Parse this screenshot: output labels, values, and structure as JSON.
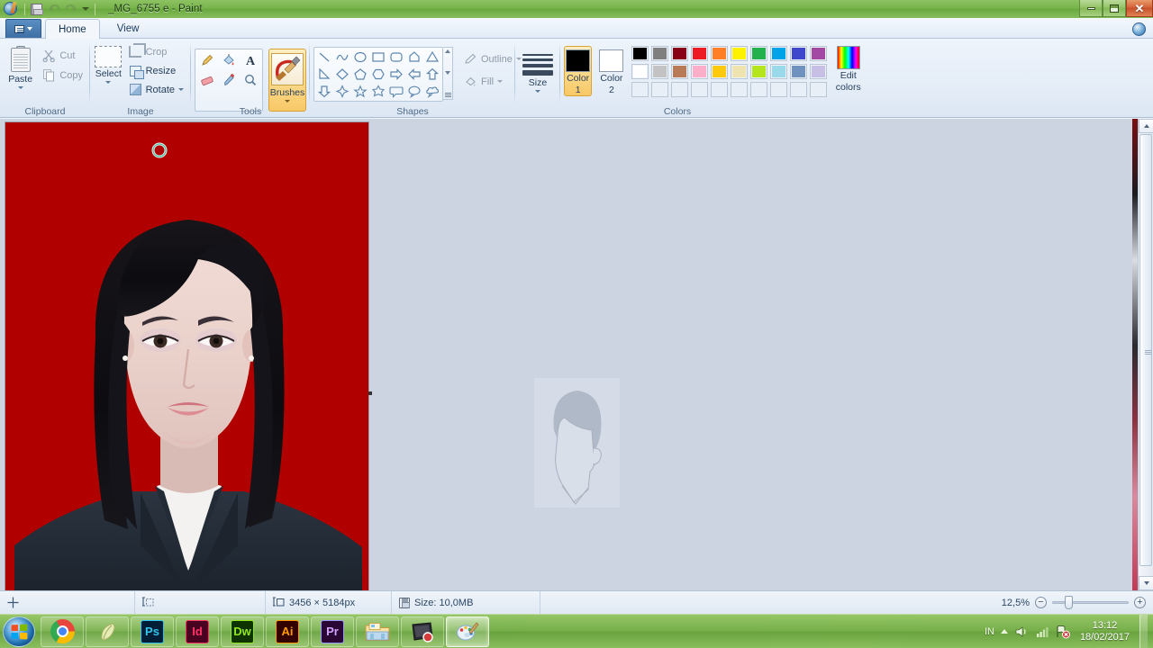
{
  "window": {
    "title": "_MG_6755 e - Paint",
    "quick_access": [
      "save-icon",
      "undo-icon",
      "redo-icon",
      "customize-qat-icon"
    ],
    "controls": {
      "minimize": "minimize-icon",
      "restore": "restore-icon",
      "close": "✕"
    },
    "help_icon": "help-icon"
  },
  "tabs": {
    "app_menu_label": "menu-icon",
    "items": [
      {
        "label": "Home",
        "active": true
      },
      {
        "label": "View",
        "active": false
      }
    ]
  },
  "ribbon": {
    "groups": [
      {
        "name": "Clipboard",
        "label": "Clipboard",
        "big_button": {
          "label": "Paste",
          "icon": "paste-icon",
          "has_caret": true
        },
        "small_buttons": [
          {
            "label": "Cut",
            "icon": "scissors-icon",
            "enabled": false
          },
          {
            "label": "Copy",
            "icon": "copy-icon",
            "enabled": false
          }
        ]
      },
      {
        "name": "Image",
        "label": "Image",
        "big_button": {
          "label": "Select",
          "icon": "select-rectangle-icon",
          "has_caret": true
        },
        "small_buttons": [
          {
            "label": "Crop",
            "icon": "crop-icon",
            "enabled": false
          },
          {
            "label": "Resize",
            "icon": "resize-icon",
            "enabled": true
          },
          {
            "label": "Rotate",
            "icon": "rotate-icon",
            "enabled": true,
            "has_caret": true
          }
        ]
      },
      {
        "name": "Tools",
        "label": "Tools",
        "tools": [
          "pencil-icon",
          "fill-with-color-icon",
          "text-icon",
          "eraser-icon",
          "color-picker-icon",
          "magnifier-icon"
        ],
        "brushes": {
          "label": "Brushes",
          "icon": "brush-icon",
          "selected": true,
          "has_caret": true
        }
      },
      {
        "name": "Shapes",
        "label": "Shapes",
        "shapes": [
          "line",
          "curve",
          "oval",
          "rectangle",
          "rounded-rectangle",
          "polygon",
          "triangle",
          "right-triangle",
          "diamond",
          "pentagon",
          "hexagon",
          "right-arrow",
          "left-arrow",
          "up-arrow",
          "down-arrow",
          "four-point-star",
          "five-point-star",
          "six-point-star",
          "rounded-callout",
          "oval-callout",
          "cloud-callout"
        ],
        "outline": {
          "label": "Outline",
          "enabled": false,
          "has_caret": true,
          "icon": "outline-icon"
        },
        "fill": {
          "label": "Fill",
          "enabled": false,
          "has_caret": true,
          "icon": "fill-icon"
        }
      },
      {
        "name": "Size",
        "label": "",
        "size_button": {
          "label": "Size",
          "icon": "size-lines-icon",
          "has_caret": true
        }
      },
      {
        "name": "Colors",
        "label": "Colors",
        "color1": {
          "label_top": "Color",
          "label_bottom": "1",
          "value": "#000000",
          "selected": true
        },
        "color2": {
          "label_top": "Color",
          "label_bottom": "2",
          "value": "#ffffff",
          "selected": false
        },
        "palette_row1": [
          "#000000",
          "#7f7f7f",
          "#880015",
          "#ed1c24",
          "#ff7f27",
          "#fff200",
          "#22b14c",
          "#00a2e8",
          "#3f48cc",
          "#a349a4"
        ],
        "palette_row2": [
          "#ffffff",
          "#c3c3c3",
          "#b97a57",
          "#ffaec9",
          "#ffc90e",
          "#efe4b0",
          "#b5e61d",
          "#99d9ea",
          "#7092be",
          "#c8bfe7"
        ],
        "palette_row3": [
          "",
          "",
          "",
          "",
          "",
          "",
          "",
          "",
          "",
          ""
        ],
        "edit_colors": {
          "label_top": "Edit",
          "label_bottom": "colors",
          "icon": "edit-colors-icon"
        }
      }
    ]
  },
  "canvas": {
    "background_color": "#ccd4e1",
    "image_background": "#b00000",
    "ghost_overlay": "id-photo-silhouette",
    "cursor": "brush-ring-cursor"
  },
  "statusbar": {
    "cursor_position": "",
    "selection_size": "",
    "image_dimensions": "3456 × 5184px",
    "file_size": "Size: 10,0MB",
    "zoom_level": "12,5%",
    "zoom_out": "−",
    "zoom_in": "+"
  },
  "taskbar": {
    "start": "windows-start-orb",
    "items": [
      {
        "name": "chrome",
        "label": "",
        "active": false
      },
      {
        "name": "app-feather",
        "label": "",
        "active": false
      },
      {
        "name": "photoshop",
        "label": "Ps",
        "active": false,
        "fg": "#31c5f0",
        "bg": "#001e36",
        "border": "#31c5f0"
      },
      {
        "name": "indesign",
        "label": "Id",
        "active": false,
        "fg": "#ff3366",
        "bg": "#49021f",
        "border": "#ff3366"
      },
      {
        "name": "dreamweaver",
        "label": "Dw",
        "active": false,
        "fg": "#8fe71f",
        "bg": "#0e3300",
        "border": "#8fe71f"
      },
      {
        "name": "illustrator",
        "label": "Ai",
        "active": false,
        "fg": "#ff9a00",
        "bg": "#330000",
        "border": "#ff9a00"
      },
      {
        "name": "premiere",
        "label": "Pr",
        "active": false,
        "fg": "#d5a3ff",
        "bg": "#2a0634",
        "border": "#9999ff"
      },
      {
        "name": "file-explorer",
        "label": "",
        "active": false
      },
      {
        "name": "media-app",
        "label": "",
        "active": false
      },
      {
        "name": "paint",
        "label": "",
        "active": true
      }
    ],
    "tray": {
      "language": "IN",
      "icons": [
        "show-hidden-icons",
        "volume-icon",
        "network-icon",
        "action-center-icon"
      ],
      "time": "13:12",
      "date": "18/02/2017"
    }
  }
}
